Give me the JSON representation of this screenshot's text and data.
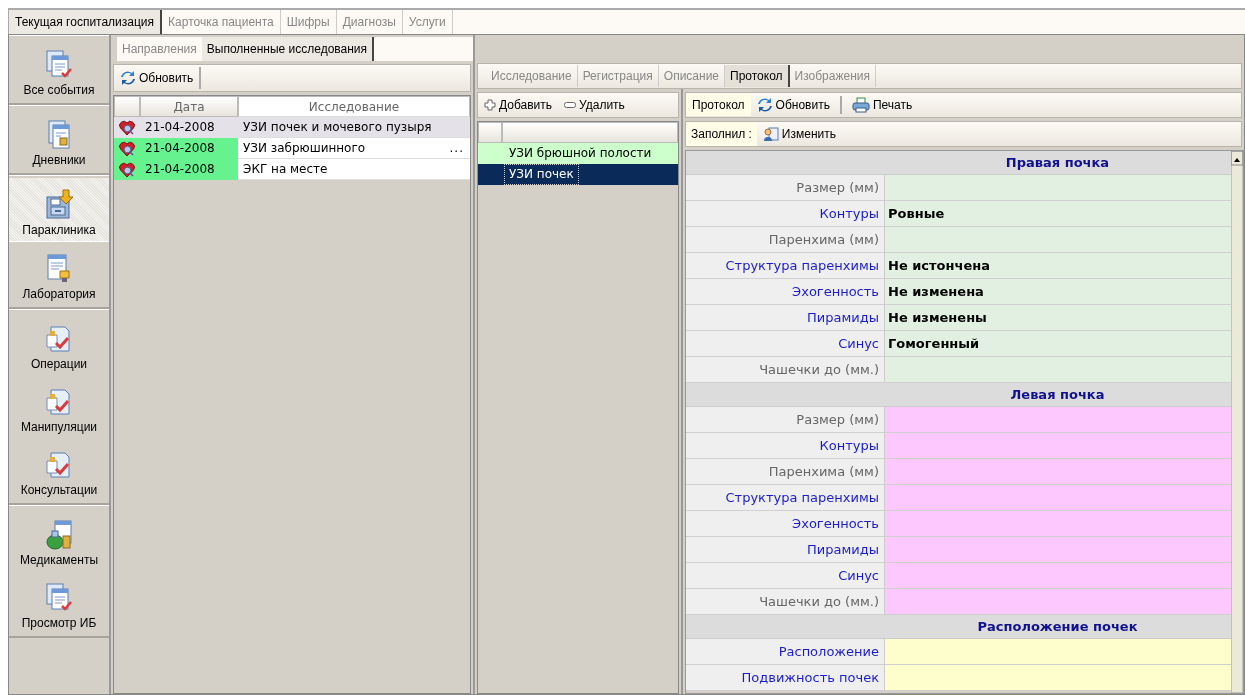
{
  "main_tabs": [
    {
      "label": "Текущая госпитализация",
      "selected": true
    },
    {
      "label": "Карточка пациента",
      "selected": false
    },
    {
      "label": "Шифры",
      "selected": false
    },
    {
      "label": "Диагнозы",
      "selected": false
    },
    {
      "label": "Услуги",
      "selected": false
    }
  ],
  "sidebar": {
    "groups": [
      {
        "items": [
          {
            "label": "Все события",
            "kind": "events",
            "selected": false
          }
        ]
      },
      {
        "items": [
          {
            "label": "Дневники",
            "kind": "diary",
            "selected": false
          }
        ]
      },
      {
        "items": [
          {
            "label": "Параклиника",
            "kind": "cabinet",
            "selected": true
          },
          {
            "label": "Лаборатория",
            "kind": "lab",
            "selected": false
          }
        ]
      },
      {
        "items": [
          {
            "label": "Операции",
            "kind": "procedure",
            "selected": false
          },
          {
            "label": "Манипуляции",
            "kind": "procedure",
            "selected": false
          },
          {
            "label": "Консультации",
            "kind": "procedure",
            "selected": false
          }
        ]
      },
      {
        "items": [
          {
            "label": "Медикаменты",
            "kind": "drugs",
            "selected": false
          },
          {
            "label": "Просмотр ИБ",
            "kind": "events",
            "selected": false
          }
        ]
      }
    ]
  },
  "studies": {
    "tabs": [
      {
        "label": "Направления",
        "selected": false
      },
      {
        "label": "Выполненные исследования",
        "selected": true
      }
    ],
    "refresh_button": "Обновить",
    "columns": [
      "Дата",
      "Исследование"
    ],
    "rows": [
      {
        "date": "21-04-2008",
        "study": "УЗИ почек и мочевого пузыря",
        "selected": true
      },
      {
        "date": "21-04-2008",
        "study": "УЗИ забрюшинного",
        "more": "...",
        "selected": false,
        "color": "#66f28e"
      },
      {
        "date": "21-04-2008",
        "study": "ЭКГ на месте",
        "selected": false,
        "color": "#66f28e"
      }
    ]
  },
  "exam": {
    "tabs": [
      {
        "label": "Исследование",
        "selected": false
      },
      {
        "label": "Регистрация",
        "selected": false
      },
      {
        "label": "Описание",
        "selected": false
      },
      {
        "label": "Протокол",
        "selected": true
      },
      {
        "label": "Изображения",
        "selected": false
      }
    ],
    "list_toolbar": {
      "add": "Добавить",
      "remove": "Удалить"
    },
    "list_rows": [
      {
        "label": "УЗИ брюшной полости",
        "selected": false
      },
      {
        "label": "УЗИ почек",
        "selected": true
      }
    ],
    "protocol_toolbar": {
      "protocol": "Протокол",
      "refresh": "Обновить",
      "print": "Печать"
    },
    "filled_by": {
      "label": "Заполнил :",
      "edit": "Изменить"
    },
    "sections": [
      {
        "title": "Правая почка",
        "color": "#e2f0e2",
        "rows": [
          {
            "label": "Размер (мм)",
            "kind": "measure"
          },
          {
            "label": "Контуры",
            "kind": "choice",
            "value": "Ровные"
          },
          {
            "label": "Паренхима (мм)",
            "kind": "measure"
          },
          {
            "label": "Структура паренхимы",
            "kind": "choice",
            "value": "Не истончена"
          },
          {
            "label": "Эхогенность",
            "kind": "choice",
            "value": "Не изменена"
          },
          {
            "label": "Пирамиды",
            "kind": "choice",
            "value": "Не изменены"
          },
          {
            "label": "Синус",
            "kind": "choice",
            "value": "Гомогенный"
          },
          {
            "label": "Чашечки до (мм.)",
            "kind": "measure"
          }
        ]
      },
      {
        "title": "Левая почка",
        "color": "#fdc8fd",
        "rows": [
          {
            "label": "Размер (мм)",
            "kind": "measure"
          },
          {
            "label": "Контуры",
            "kind": "choice"
          },
          {
            "label": "Паренхима (мм)",
            "kind": "measure"
          },
          {
            "label": "Структура паренхимы",
            "kind": "choice"
          },
          {
            "label": "Эхогенность",
            "kind": "choice"
          },
          {
            "label": "Пирамиды",
            "kind": "choice"
          },
          {
            "label": "Синус",
            "kind": "choice"
          },
          {
            "label": "Чашечки до (мм.)",
            "kind": "measure"
          }
        ]
      },
      {
        "title": "Расположение почек",
        "color": "#fefecc",
        "rows": [
          {
            "label": "Расположение",
            "kind": "choice"
          },
          {
            "label": "Подвижность почек",
            "kind": "choice"
          }
        ]
      }
    ]
  }
}
